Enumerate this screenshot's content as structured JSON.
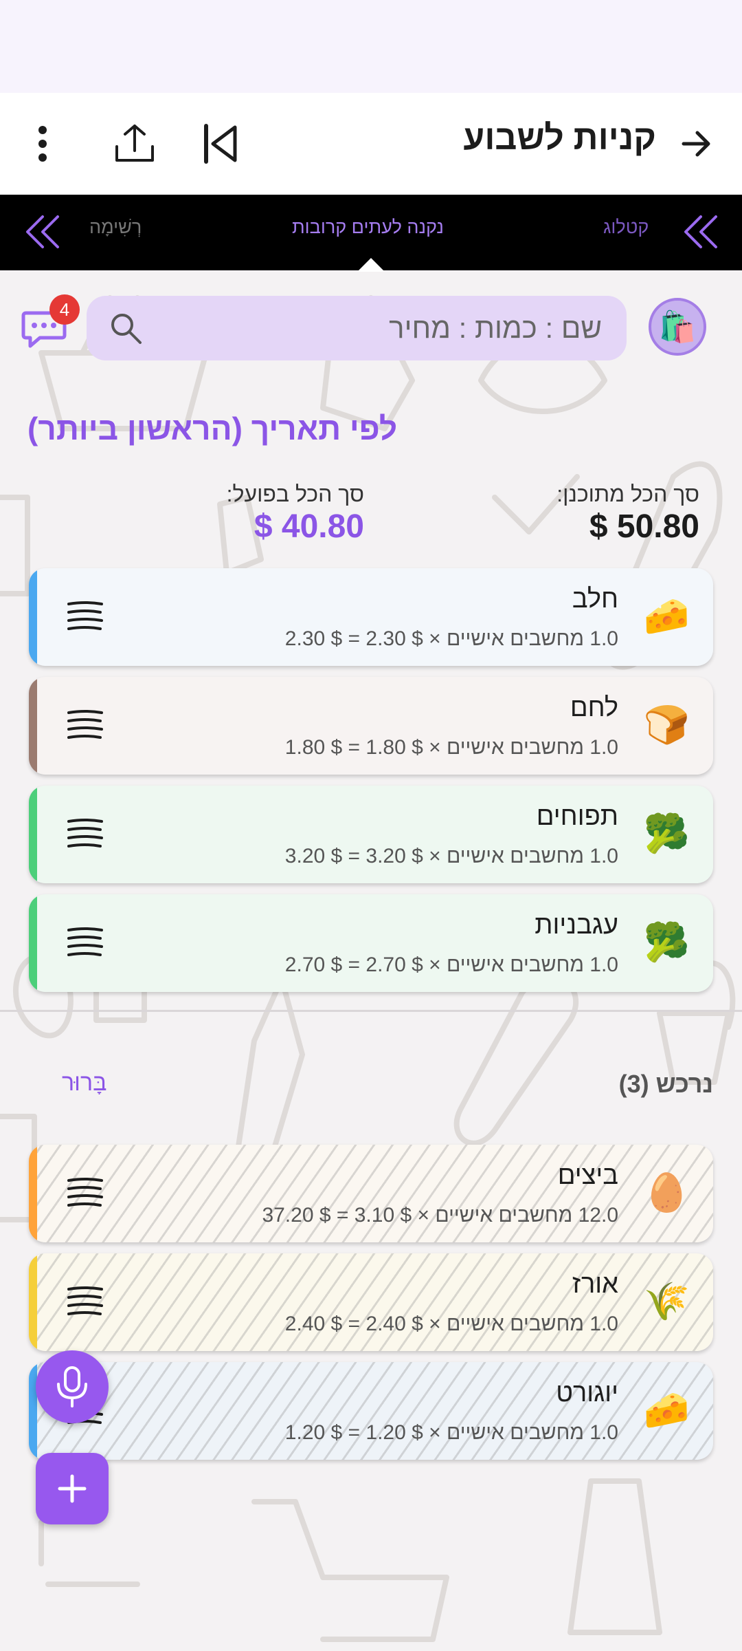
{
  "app_bar": {
    "title": "קניות לשבוע",
    "back_icon": "arrow-right-icon",
    "collapse_icon": "skip-previous-icon",
    "share_icon": "share-upload-icon",
    "menu_icon": "more-vert-icon"
  },
  "tabs": {
    "left": "רְשִׁימָה",
    "center": "נקנה לעתים קרובות",
    "right": "קטלוג"
  },
  "search": {
    "placeholder": "שם : כמות : מחיר",
    "chat_badge": "4"
  },
  "sort_label": "לפי תאריך (הראשון ביותר)",
  "totals": {
    "planned_label": "סך הכל מתוכנן:",
    "planned_value": "$ 50.80",
    "actual_label": "סך הכל בפועל:",
    "actual_value": "$ 40.80"
  },
  "active_items": [
    {
      "name": "חלב",
      "calc": "1.0 מחשבים אישיים × $ 2.30 = $ 2.30",
      "emoji": "🧀",
      "stripe": "#4aa8f0",
      "bg": "#f3f7fb"
    },
    {
      "name": "לחם",
      "calc": "1.0 מחשבים אישיים × $ 1.80 = $ 1.80",
      "emoji": "🍞",
      "stripe": "#9b7b70",
      "bg": "#f7f3f2"
    },
    {
      "name": "תפוחים",
      "calc": "1.0 מחשבים אישיים × $ 3.20 = $ 3.20",
      "emoji": "🥦",
      "stripe": "#4ccf7a",
      "bg": "#eef8f1"
    },
    {
      "name": "עגבניות",
      "calc": "1.0 מחשבים אישיים × $ 2.70 = $ 2.70",
      "emoji": "🥦",
      "stripe": "#4ccf7a",
      "bg": "#eef8f1"
    }
  ],
  "done_section": {
    "header": "נרכש (3)",
    "clear_label": "בָּרוּר"
  },
  "done_items": [
    {
      "name": "ביצים",
      "calc": "12.0 מחשבים אישיים × $ 3.10 = $ 37.20",
      "emoji": "🥚",
      "stripe": "#ffa33a",
      "bg": "#fbf7f1"
    },
    {
      "name": "אורז",
      "calc": "1.0 מחשבים אישיים × $ 2.40 = $ 2.40",
      "emoji": "🌾",
      "stripe": "#f5cf3a",
      "bg": "#fbf8ec"
    },
    {
      "name": "יוגורט",
      "calc": "1.0 מחשבים אישיים × $ 1.20 = $ 1.20",
      "emoji": "🧀",
      "stripe": "#4aa8f0",
      "bg": "#eef3f8"
    }
  ],
  "fabs": {
    "mic_icon": "microphone-icon",
    "add_icon": "plus-icon"
  },
  "colors": {
    "accent": "#8b55e6",
    "fab": "#9758ee",
    "search_bg": "#e4d6f7",
    "tabs_bg": "#000000"
  }
}
